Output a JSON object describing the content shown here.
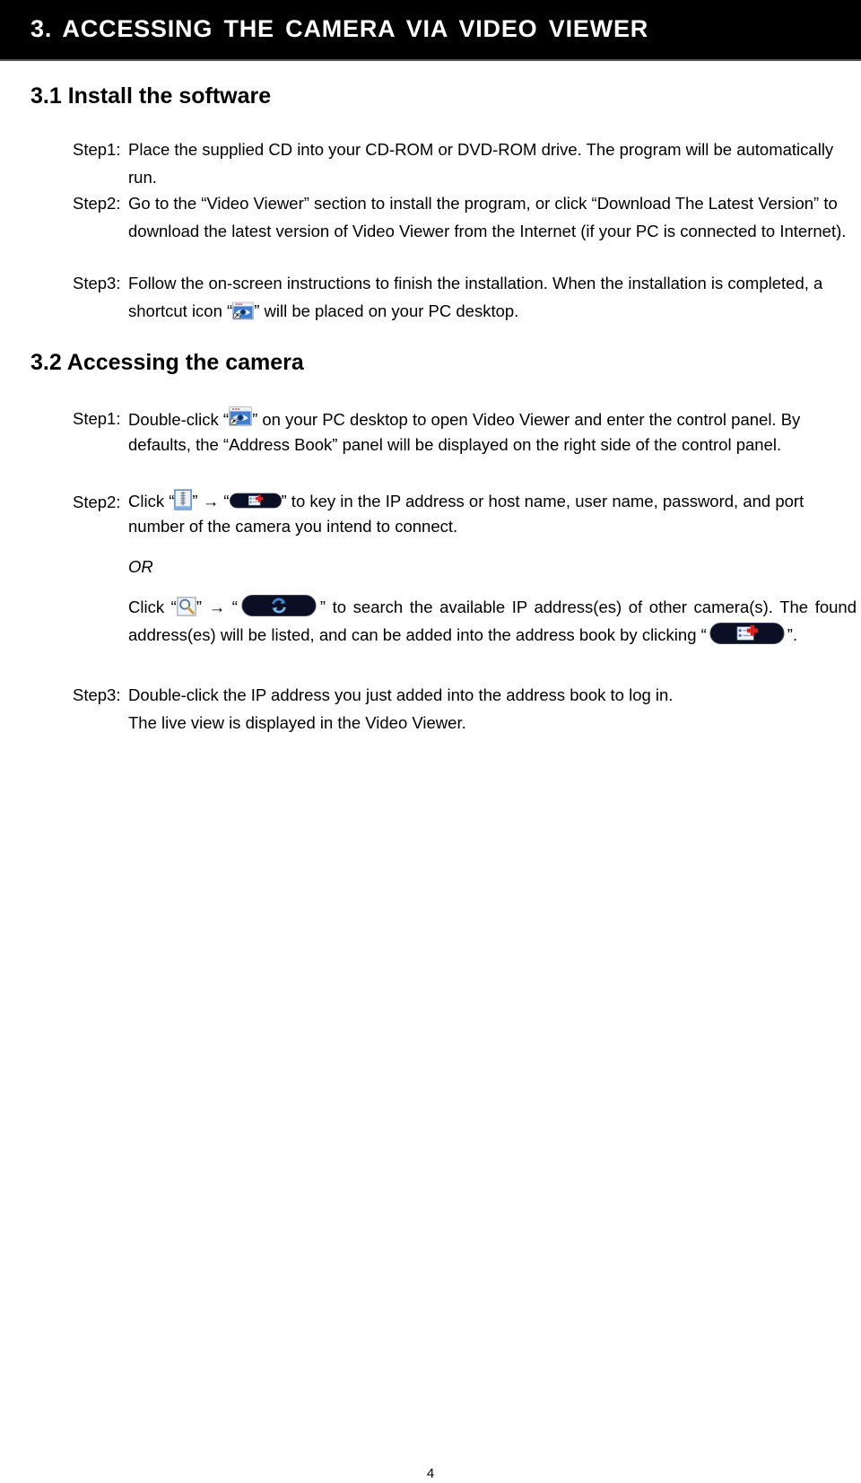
{
  "banner": {
    "title": "3. ACCESSING THE CAMERA VIA VIDEO VIEWER"
  },
  "section_1": {
    "heading": "3.1 Install the software",
    "steps": [
      {
        "label": "Step1:",
        "text": "Place the supplied CD into your CD-ROM or DVD-ROM drive. The program will be automatically run."
      },
      {
        "label": "Step2:",
        "text": "Go to the “Video Viewer” section to install the program, or click “Download The Latest Version” to download the latest version of Video Viewer from the Internet (if your PC is connected to Internet)."
      },
      {
        "label": "Step3:",
        "text_before_icon": "Follow the on-screen instructions to finish the installation. When the installation is completed, a shortcut icon “",
        "icon": "video-viewer-shortcut-icon",
        "text_after_icon": "” will be placed on your PC desktop."
      }
    ]
  },
  "section_2": {
    "heading": "3.2 Accessing the camera",
    "step1": {
      "label": "Step1:",
      "text_before_icon": "Double-click “",
      "icon": "video-viewer-shortcut-icon",
      "text_after_icon": "” on your PC desktop to open Video Viewer and enter the control panel. By defaults, the “Address Book” panel will be displayed on the right side of the control panel."
    },
    "step2": {
      "label": "Step2:",
      "prefix": "Click “",
      "icon_1": "address-book-icon",
      "arrow": "” → “",
      "icon_2": "add-address-button-icon",
      "suffix": "” to key in the IP address or host name, user name, password, and port number of the camera you intend to connect."
    },
    "or_label": "OR",
    "alt": {
      "prefix": "Click “",
      "icon_1": "search-icon",
      "arrow": "” → “",
      "icon_2": "refresh-search-button-icon",
      "middle": "” to search the available IP address(es) of other camera(s). The found address(es) will be listed, and can be added into the address book by clicking “",
      "icon_3": "add-address-button-icon",
      "suffix": "”."
    },
    "step3": {
      "label": "Step3:",
      "line1": "Double-click the IP address you just added into the address book to log in.",
      "line2": "The live view is displayed in the Video Viewer."
    }
  },
  "footer": {
    "page_number": "4"
  },
  "colors": {
    "banner_bg": "#000000",
    "banner_text": "#ffffff",
    "pill_bg": "#0a0f24",
    "add_cross": "#e02020",
    "refresh_blue": "#3a8ad8"
  }
}
